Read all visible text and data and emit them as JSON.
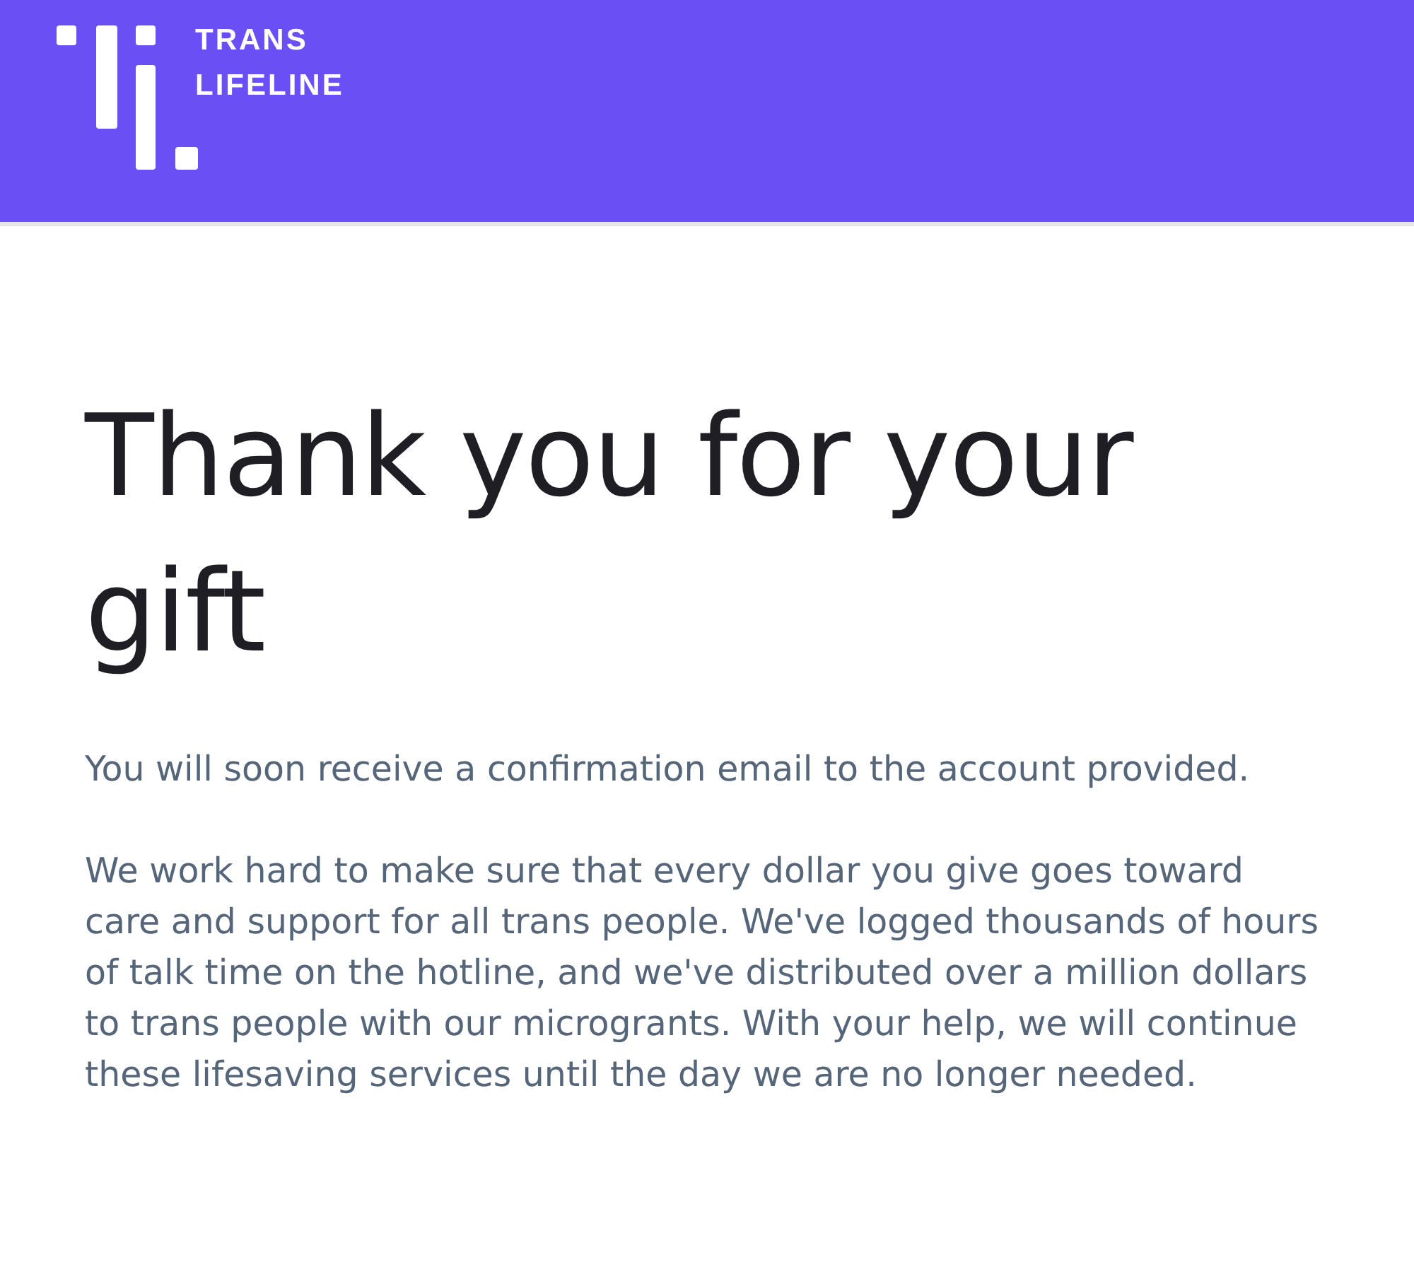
{
  "header": {
    "logo_lines": [
      "TRANS",
      "LIFELINE"
    ]
  },
  "heading": "Thank you for your gift",
  "paragraphs": [
    "You will soon receive a confirmation email to the account provided.",
    "We work hard to make sure that every dollar you give goes toward care and support for all trans people. We've logged thousands of hours of talk time on the hotline, and we've distributed over a million dollars to trans people with our microgrants. With your help, we will continue these lifesaving services until the day we are no longer needed."
  ]
}
